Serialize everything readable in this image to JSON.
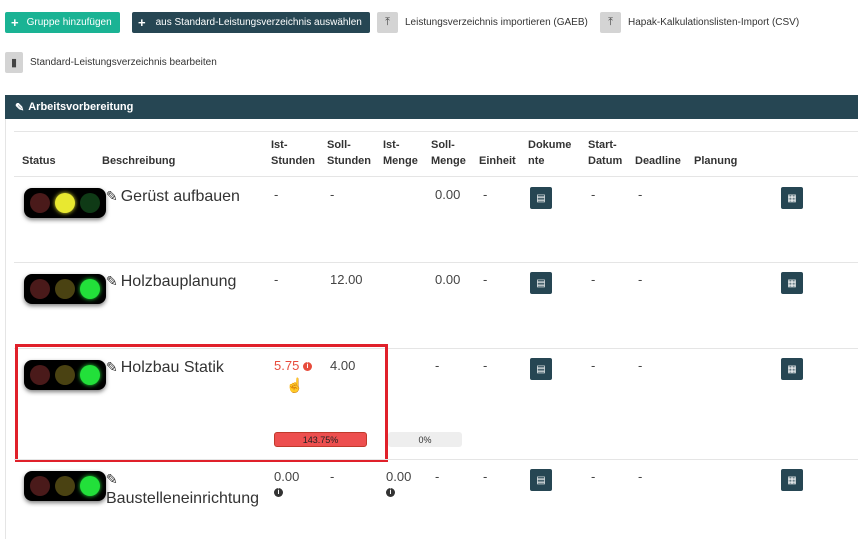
{
  "toolbar": {
    "add_group": "Gruppe hinzufügen",
    "select_standard": "aus Standard-Leistungsverzeichnis auswählen",
    "import_gaeb": "Leistungsverzeichnis importieren (GAEB)",
    "import_csv": "Hapak-Kalkulationslisten-Import (CSV)",
    "edit_standard": "Standard-Leistungsverzeichnis bearbeiten",
    "plus_icon": "+",
    "upload_icon": "⤒",
    "clipboard_icon": "▮"
  },
  "panel": {
    "title": "Arbeitsvorbereitung",
    "pencil_icon": "✎"
  },
  "columns": {
    "status": "Status",
    "beschreibung": "Beschreibung",
    "ist_stunden_1": "Ist-",
    "ist_stunden_2": "Stunden",
    "soll_stunden_1": "Soll-",
    "soll_stunden_2": "Stunden",
    "ist_menge_1": "Ist-",
    "ist_menge_2": "Menge",
    "soll_menge_1": "Soll-",
    "soll_menge_2": "Menge",
    "einheit": "Einheit",
    "dokumente_1": "Dokume",
    "dokumente_2": "nte",
    "start_1": "Start-",
    "start_2": "Datum",
    "deadline": "Deadline",
    "planung": "Planung"
  },
  "rows": [
    {
      "status": "yellow",
      "beschreibung": "Gerüst aufbauen",
      "ist_stunden": "-",
      "soll_stunden": "-",
      "ist_menge": "",
      "soll_menge": "0.00",
      "einheit": "-",
      "start": "-",
      "deadline": "-"
    },
    {
      "status": "green",
      "beschreibung": "Holzbauplanung",
      "ist_stunden": "-",
      "soll_stunden": "12.00",
      "ist_menge": "",
      "soll_menge": "0.00",
      "einheit": "-",
      "start": "-",
      "deadline": "-"
    },
    {
      "status": "green",
      "beschreibung": "Holzbau Statik",
      "ist_stunden": "5.75",
      "soll_stunden": "4.00",
      "ist_menge": "",
      "soll_menge": "-",
      "einheit": "-",
      "start": "-",
      "deadline": "-",
      "hours_progress": "143.75%",
      "qty_progress": "0%"
    },
    {
      "status": "green",
      "beschreibung": "Baustelleneinrichtung",
      "ist_stunden": "0.00",
      "soll_stunden": "-",
      "ist_menge": "0.00",
      "soll_menge": "-",
      "einheit": "-",
      "start": "-",
      "deadline": "-"
    }
  ],
  "icons": {
    "info": "i",
    "doc": "▤",
    "calendar": "▦",
    "pencil": "✎",
    "hand": "☝"
  },
  "colors": {
    "primary_dark": "#264653",
    "accent_green": "#1ab394",
    "danger_red": "#e74c3c"
  }
}
